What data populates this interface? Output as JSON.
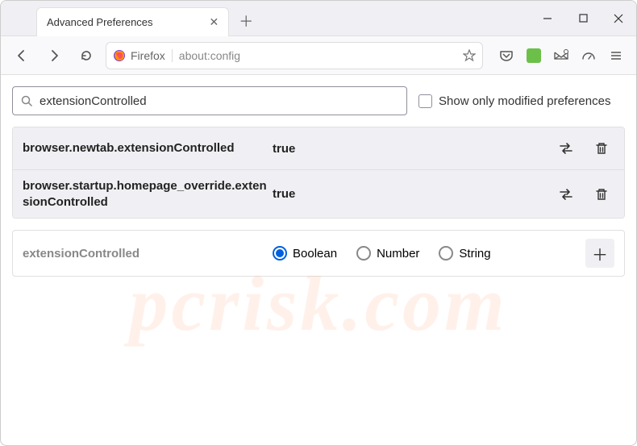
{
  "window": {
    "tab_title": "Advanced Preferences",
    "identity_label": "Firefox",
    "url": "about:config"
  },
  "search": {
    "value": "extensionControlled",
    "checkbox_label": "Show only modified preferences"
  },
  "prefs": [
    {
      "name": "browser.newtab.extensionControlled",
      "value": "true"
    },
    {
      "name": "browser.startup.homepage_override.extensionControlled",
      "value": "true"
    }
  ],
  "new_pref": {
    "name": "extensionControlled",
    "types": [
      "Boolean",
      "Number",
      "String"
    ],
    "selected": "Boolean"
  },
  "watermark": "pcrisk.com"
}
